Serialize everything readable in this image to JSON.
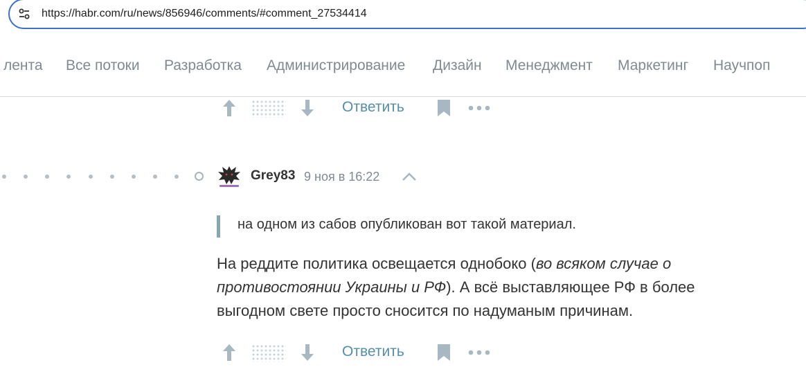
{
  "browser": {
    "url": "https://habr.com/ru/news/856946/comments/#comment_27534414",
    "site_info_icon": "tune-icon"
  },
  "nav": {
    "items": [
      {
        "label": "лента"
      },
      {
        "label": "Все потоки"
      },
      {
        "label": "Разработка"
      },
      {
        "label": "Администрирование"
      },
      {
        "label": "Дизайн"
      },
      {
        "label": "Менеджмент"
      },
      {
        "label": "Маркетинг"
      },
      {
        "label": "Научпоп"
      }
    ]
  },
  "actions": {
    "reply_label": "Ответить",
    "icons": [
      "arrow-up-icon",
      "arrow-down-icon",
      "bookmark-icon",
      "more-icon"
    ]
  },
  "comment": {
    "author": "Grey83",
    "date": "9 ноя в 16:22",
    "quote": "на одном из сабов опубликован вот такой материал.",
    "body_part1": "На реддите политика освещается однобоко (",
    "body_italic": "во всяком случае о противостоянии Украины и РФ",
    "body_part2": "). А всё выставляющее РФ в более выгодном свете просто сносится по надуманым причинам."
  },
  "colors": {
    "accent": "#548eaa",
    "quote_border": "#86a6b4",
    "nav_text": "#7f8a91",
    "url_border": "#3a6fd0"
  }
}
